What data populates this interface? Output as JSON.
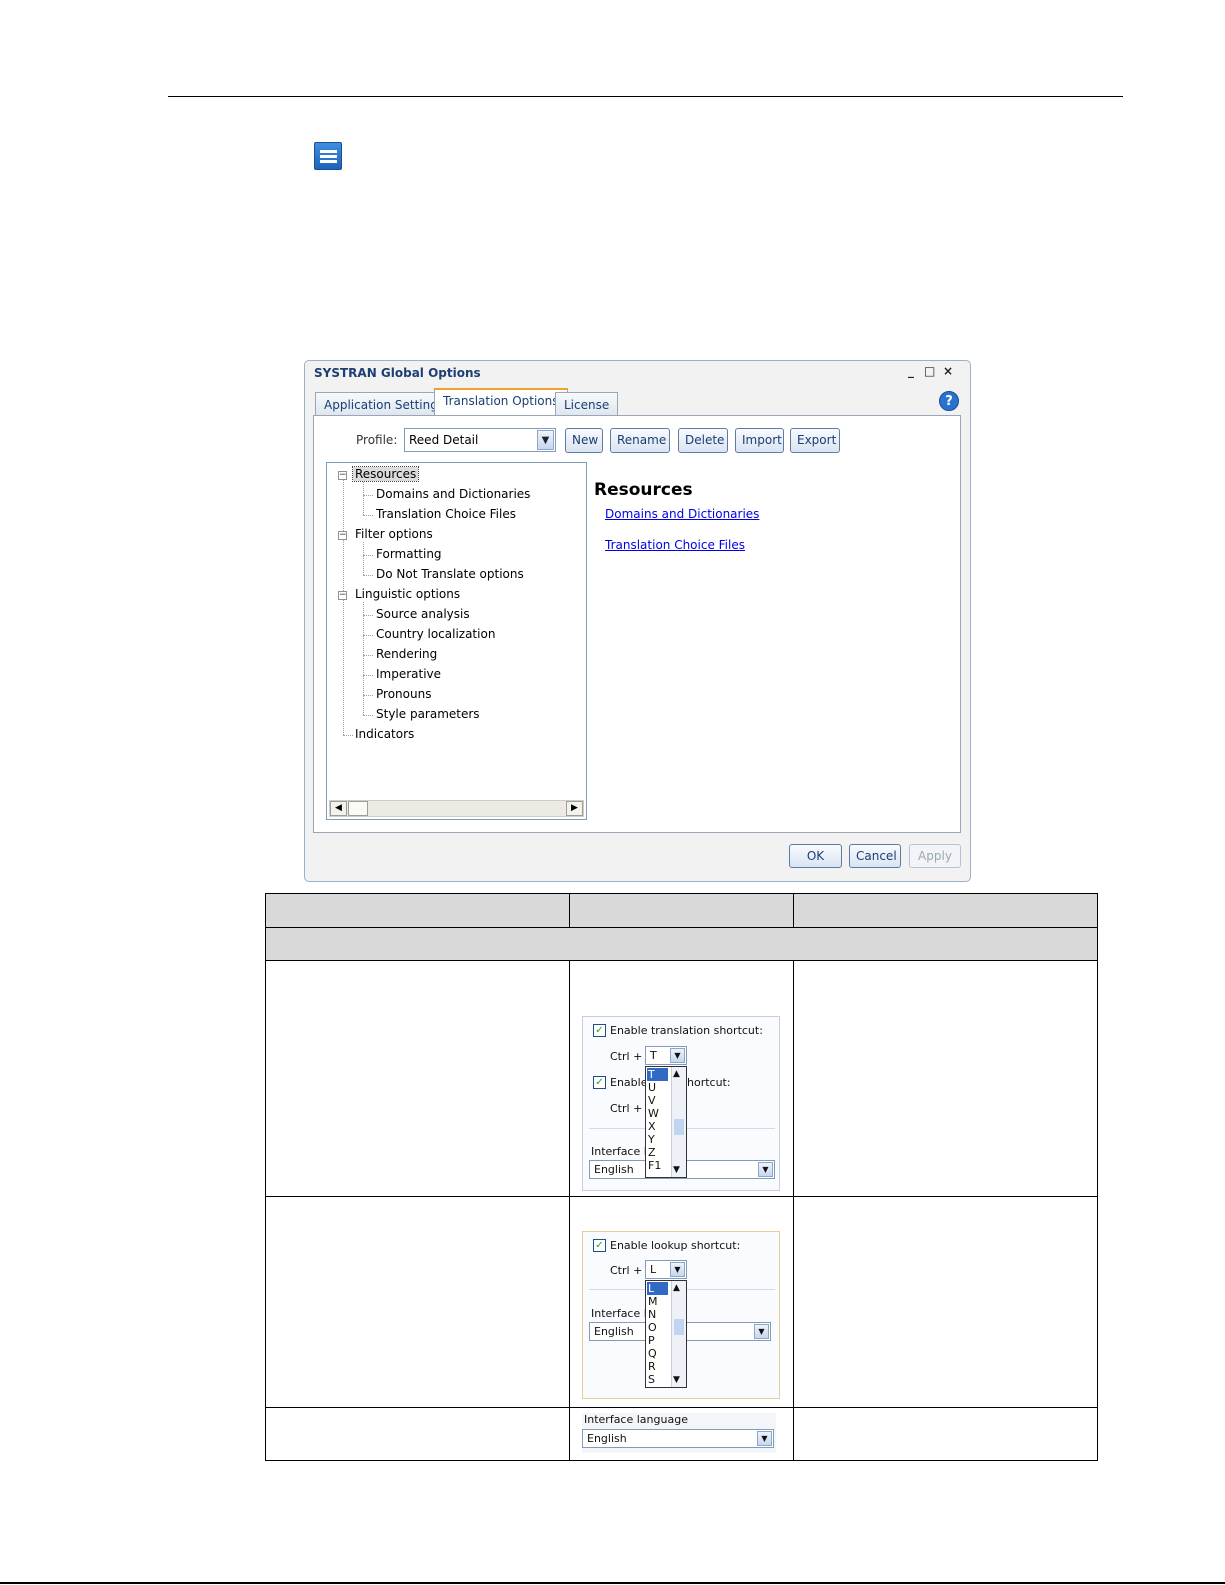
{
  "dialog": {
    "title": "SYSTRAN Global Options",
    "window_controls": [
      "_",
      "□",
      "×"
    ],
    "tabs": [
      {
        "label": "Application Settings",
        "active": false
      },
      {
        "label": "Translation Options",
        "active": true
      },
      {
        "label": "License",
        "active": false
      }
    ],
    "help_glyph": "?",
    "profile_label": "Profile:",
    "profile_value": "Reed Detail",
    "profile_buttons": [
      "New",
      "Rename",
      "Delete",
      "Import",
      "Export"
    ],
    "tree": [
      {
        "label": "Resources",
        "level": 0,
        "expander": "−",
        "selected": true
      },
      {
        "label": "Domains and Dictionaries",
        "level": 1
      },
      {
        "label": "Translation Choice Files",
        "level": 1
      },
      {
        "label": "Filter options",
        "level": 0,
        "expander": "−"
      },
      {
        "label": "Formatting",
        "level": 1
      },
      {
        "label": "Do Not Translate options",
        "level": 1
      },
      {
        "label": "Linguistic options",
        "level": 0,
        "expander": "−"
      },
      {
        "label": "Source analysis",
        "level": 1
      },
      {
        "label": "Country localization",
        "level": 1
      },
      {
        "label": "Rendering",
        "level": 1
      },
      {
        "label": "Imperative",
        "level": 1
      },
      {
        "label": "Pronouns",
        "level": 1
      },
      {
        "label": "Style parameters",
        "level": 1
      },
      {
        "label": "Indicators",
        "level": 0
      }
    ],
    "content_heading": "Resources",
    "content_links": [
      "Domains and Dictionaries",
      "Translation Choice Files"
    ],
    "footer_buttons": {
      "ok": "OK",
      "cancel": "Cancel",
      "apply": "Apply"
    }
  },
  "snap1": {
    "checkbox1_label": "Enable translation shortcut:",
    "ctrl_label": "Ctrl +",
    "select_value": "T",
    "checkbox2_label_a": "Enable",
    "checkbox2_label_b": "hortcut:",
    "ctrl_label2": "Ctrl +",
    "interface_label": "Interface la",
    "interface_value": "English",
    "options": [
      "T",
      "U",
      "V",
      "W",
      "X",
      "Y",
      "Z",
      "F1"
    ]
  },
  "snap2": {
    "checkbox_label": "Enable lookup shortcut:",
    "ctrl_label": "Ctrl +",
    "select_value": "L",
    "interface_label": "Interface la",
    "interface_value": "English",
    "options": [
      "L",
      "M",
      "N",
      "O",
      "P",
      "Q",
      "R",
      "S"
    ]
  },
  "snap3": {
    "interface_label": "Interface language",
    "interface_value": "English"
  },
  "colors": {
    "accent": "#f0a22a",
    "title": "#1e3f73",
    "link": "#0000e6",
    "table_header": "#d9d9d9"
  },
  "icons": [
    "menu-icon",
    "help-icon",
    "chevron-down-icon",
    "scroll-left-icon",
    "scroll-right-icon",
    "checkbox-icon"
  ]
}
